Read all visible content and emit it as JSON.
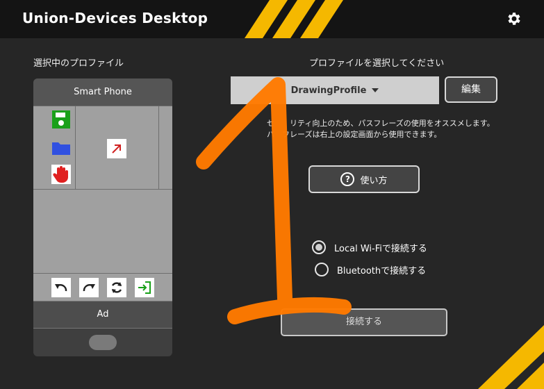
{
  "app": {
    "title": "Union-Devices Desktop"
  },
  "colors": {
    "accent": "#F5B800",
    "background": "#262626",
    "titlebar": "#141414",
    "overlay_stroke": "#FF7A00"
  },
  "left_panel": {
    "heading": "選択中のプロファイル",
    "phone": {
      "header": "Smart Phone",
      "grid_icons": [
        "save-icon",
        "folder-icon",
        "hand-stop-icon",
        "arrow-up-right-icon"
      ],
      "toolbar_icons": [
        "undo-icon",
        "redo-icon",
        "sync-icon",
        "login-icon"
      ],
      "ad_label": "Ad"
    }
  },
  "right_panel": {
    "heading": "プロファイルを選択してください",
    "profile_select": {
      "selected": "DrawingProfile"
    },
    "edit_label": "編集",
    "notice_line1": "セ　　リティ向上のため、パスフレーズの使用をオススメします。",
    "notice_line2": "パ　フレーズは右上の設定画面から使用できます。",
    "help_label": "使い方",
    "connection_options": [
      {
        "label": "Local Wi-Fiで接続する",
        "selected": true
      },
      {
        "label": "Bluetoothで接続する",
        "selected": false
      }
    ],
    "connect_label": "接続する"
  },
  "overlay": {
    "annotation": "1"
  }
}
